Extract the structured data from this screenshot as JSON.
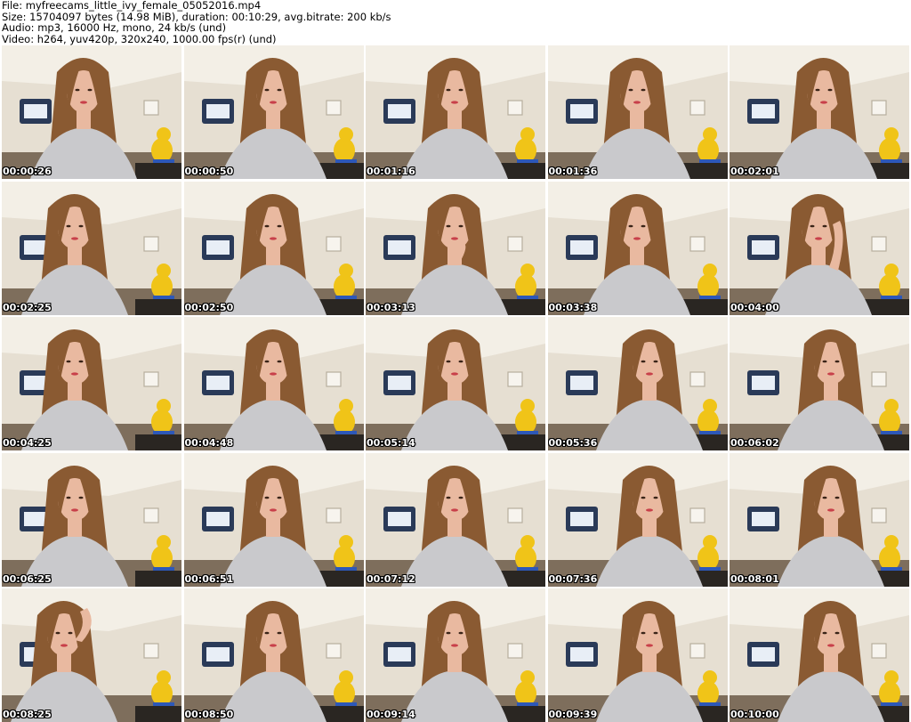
{
  "header": {
    "file": "File: myfreecams_little_ivy_female_05052016.mp4",
    "size": "Size: 15704097 bytes (14.98 MiB), duration: 00:10:29, avg.bitrate: 200 kb/s",
    "audio": "Audio: mp3, 16000 Hz, mono, 24 kb/s (und)",
    "video": "Video: h264, yuv420p, 320x240, 1000.00 fps(r) (und)"
  },
  "thumbnails": [
    {
      "time": "00:00:26",
      "pose": "tilt-right"
    },
    {
      "time": "00:00:50",
      "pose": "center"
    },
    {
      "time": "00:01:16",
      "pose": "center"
    },
    {
      "time": "00:01:36",
      "pose": "center"
    },
    {
      "time": "00:02:01",
      "pose": "tilt-left"
    },
    {
      "time": "00:02:25",
      "pose": "left"
    },
    {
      "time": "00:02:50",
      "pose": "center"
    },
    {
      "time": "00:03:13",
      "pose": "hand-chin"
    },
    {
      "time": "00:03:38",
      "pose": "center"
    },
    {
      "time": "00:04:00",
      "pose": "hand-hair"
    },
    {
      "time": "00:04:25",
      "pose": "left"
    },
    {
      "time": "00:04:48",
      "pose": "center"
    },
    {
      "time": "00:05:14",
      "pose": "center"
    },
    {
      "time": "00:05:36",
      "pose": "right"
    },
    {
      "time": "00:06:02",
      "pose": "right"
    },
    {
      "time": "00:06:25",
      "pose": "left"
    },
    {
      "time": "00:06:51",
      "pose": "center"
    },
    {
      "time": "00:07:12",
      "pose": "center"
    },
    {
      "time": "00:07:36",
      "pose": "right"
    },
    {
      "time": "00:08:01",
      "pose": "right"
    },
    {
      "time": "00:08:25",
      "pose": "arm-up"
    },
    {
      "time": "00:08:50",
      "pose": "center"
    },
    {
      "time": "00:09:14",
      "pose": "center"
    },
    {
      "time": "00:09:39",
      "pose": "right"
    },
    {
      "time": "00:10:00",
      "pose": "right"
    }
  ],
  "colors": {
    "wall": "#e6dfd2",
    "ceiling": "#f3efe6",
    "window": "#2a3a58",
    "hair": "#8a5a32",
    "skin": "#e9b9a0",
    "top": "#c9c9cc",
    "duck": "#f0c418",
    "floor": "#6b5a48",
    "timestamp_text": "#ffffff"
  }
}
